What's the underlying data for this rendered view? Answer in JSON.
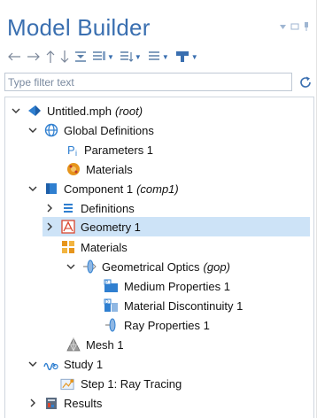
{
  "panel": {
    "title": "Model Builder"
  },
  "toolbar": {
    "buttons": [
      "back-arrow-icon",
      "forward-arrow-icon",
      "up-arrow-icon",
      "down-arrow-icon",
      "collapse-icon",
      "show-options-icon",
      "sort-icon",
      "expand-options-icon",
      "add-node-icon"
    ]
  },
  "filter": {
    "placeholder": "Type filter text",
    "value": ""
  },
  "tree": {
    "root": {
      "label": "Untitled.mph",
      "note": "(root)"
    },
    "global_definitions": {
      "label": "Global Definitions"
    },
    "parameters": {
      "label": "Parameters 1"
    },
    "global_materials": {
      "label": "Materials"
    },
    "component": {
      "label": "Component 1",
      "note": "(comp1)"
    },
    "definitions": {
      "label": "Definitions"
    },
    "geometry": {
      "label": "Geometry 1"
    },
    "comp_materials": {
      "label": "Materials"
    },
    "gop": {
      "label": "Geometrical Optics",
      "note": "(gop)"
    },
    "medium_properties": {
      "label": "Medium Properties 1"
    },
    "material_discontinuity": {
      "label": "Material Discontinuity 1"
    },
    "ray_properties": {
      "label": "Ray Properties 1"
    },
    "mesh": {
      "label": "Mesh 1"
    },
    "study": {
      "label": "Study 1"
    },
    "step": {
      "label": "Step 1: Ray Tracing"
    },
    "results": {
      "label": "Results"
    }
  },
  "colors": {
    "title": "#3a6fb0",
    "selection": "#cde3f7",
    "icon_blue": "#2f7fd0",
    "icon_orange": "#e6951c",
    "icon_red": "#d9462f"
  }
}
